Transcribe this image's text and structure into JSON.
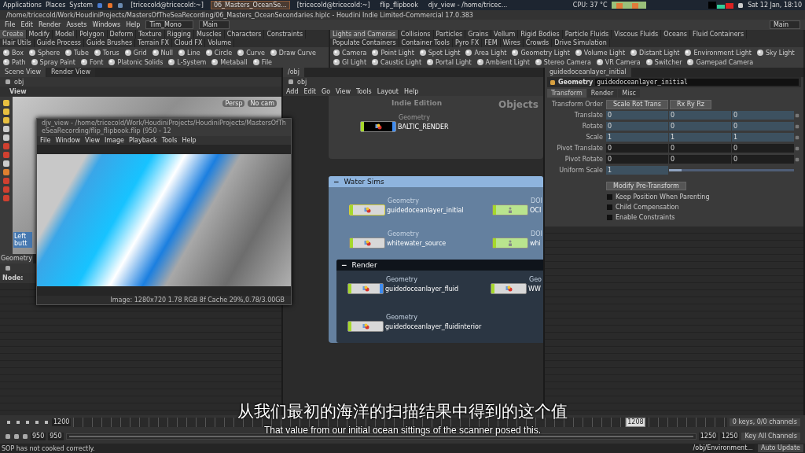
{
  "system_bar": {
    "menus": [
      "Applications",
      "Places",
      "System"
    ],
    "tasks": [
      {
        "label": "[tricecold@tricecold:~]",
        "selected": false
      },
      {
        "label": "06_Masters_OceanSe...",
        "selected": true
      },
      {
        "label": "[tricecold@tricecold:~]",
        "selected": false
      },
      {
        "label": "flip_flipbook",
        "selected": false
      },
      {
        "label": "djv_view - /home/tricec...",
        "selected": false
      }
    ],
    "cpu": "CPU: 37 °C",
    "clock": "Sat 12 Jan, 18:10"
  },
  "window": {
    "title": "/home/tricecold/Work/HoudiniProjects/MastersOfTheSeaRecording/06_Masters_OceanSecondaries.hiplc - Houdini Indie Limited-Commercial 17.0.383"
  },
  "menu": {
    "items": [
      "File",
      "Edit",
      "Render",
      "Assets",
      "Windows",
      "Help"
    ],
    "desktop": "Tim_Mono",
    "layout": "Main",
    "right_layout": "Main"
  },
  "shelves": [
    {
      "tabs": [
        {
          "label": "Create",
          "selected": true
        },
        {
          "label": "Modify",
          "selected": false
        },
        {
          "label": "Model",
          "selected": false
        },
        {
          "label": "Polygon",
          "selected": false
        },
        {
          "label": "Deform",
          "selected": false
        },
        {
          "label": "Texture",
          "selected": false
        },
        {
          "label": "Rigging",
          "selected": false
        },
        {
          "label": "Muscles",
          "selected": false
        },
        {
          "label": "Characters",
          "selected": false
        },
        {
          "label": "Constraints",
          "selected": false
        },
        {
          "label": "Hair Utils",
          "selected": false
        },
        {
          "label": "Guide Process",
          "selected": false
        },
        {
          "label": "Guide Brushes",
          "selected": false
        },
        {
          "label": "Terrain FX",
          "selected": false
        },
        {
          "label": "Cloud FX",
          "selected": false
        },
        {
          "label": "Volume",
          "selected": false
        }
      ],
      "tools": [
        "Box",
        "Sphere",
        "Tube",
        "Torus",
        "Grid",
        "Null",
        "Line",
        "Circle",
        "Curve",
        "Draw Curve",
        "Path",
        "Spray Paint",
        "Font",
        "Platonic Solids",
        "L-System",
        "Metaball",
        "File"
      ]
    },
    {
      "tabs": [
        {
          "label": "Lights and Cameras",
          "selected": true
        },
        {
          "label": "Collisions",
          "selected": false
        },
        {
          "label": "Particles",
          "selected": false
        },
        {
          "label": "Grains",
          "selected": false
        },
        {
          "label": "Vellum",
          "selected": false
        },
        {
          "label": "Rigid Bodies",
          "selected": false
        },
        {
          "label": "Particle Fluids",
          "selected": false
        },
        {
          "label": "Viscous Fluids",
          "selected": false
        },
        {
          "label": "Oceans",
          "selected": false
        },
        {
          "label": "Fluid Containers",
          "selected": false
        },
        {
          "label": "Populate Containers",
          "selected": false
        },
        {
          "label": "Container Tools",
          "selected": false
        },
        {
          "label": "Pyro FX",
          "selected": false
        },
        {
          "label": "FEM",
          "selected": false
        },
        {
          "label": "Wires",
          "selected": false
        },
        {
          "label": "Crowds",
          "selected": false
        },
        {
          "label": "Drive Simulation",
          "selected": false
        }
      ],
      "tools": [
        "Camera",
        "Point Light",
        "Spot Light",
        "Area Light",
        "Geometry Light",
        "Volume Light",
        "Distant Light",
        "Environment Light",
        "Sky Light",
        "GI Light",
        "Caustic Light",
        "Portal Light",
        "Ambient Light",
        "Stereo Camera",
        "VR Camera",
        "Switcher",
        "Gamepad Camera"
      ]
    }
  ],
  "scene_view": {
    "tabs": [
      {
        "label": "Scene View",
        "selected": true
      },
      {
        "label": "Render View",
        "selected": false
      }
    ],
    "path": "obj",
    "header": "View",
    "camera": "Persp",
    "cam": "No cam",
    "hint": "Left butt",
    "geometry_tab": "Geometry",
    "node_label": "Node:"
  },
  "flipbook": {
    "title": "djv_view - /home/tricecold/Work/HoudiniProjects/HoudiniProjects/MastersOfTheSeaRecording/flip_flipbook.flip (950 - 12",
    "menus": [
      "File",
      "Window",
      "View",
      "Image",
      "Playback",
      "Tools",
      "Help"
    ],
    "status": "Image: 1280x720 1.78 RGB 8f Cache 29%,0.78/3.00GB"
  },
  "network": {
    "tab": "/obj",
    "path": "obj",
    "menus": [
      "Add",
      "Edit",
      "Go",
      "View",
      "Tools",
      "Layout",
      "Help"
    ],
    "edition": "Indie Edition",
    "context": "Objects",
    "top_node": {
      "type": "Geometry",
      "name": "BALTIC_RENDER",
      "kind": "geo",
      "selected": false,
      "render": true
    },
    "boxes": [
      {
        "title": "Water Sims",
        "toggle": "−",
        "expanded": true,
        "nodes": [
          {
            "type": "Geometry",
            "name": "guidedoceanlayer_initial",
            "kind": "geo",
            "selected": true,
            "render": false
          },
          {
            "type": "DOI",
            "name": "OCI",
            "kind": "dop",
            "selected": false,
            "render": false
          },
          {
            "type": "Geometry",
            "name": "whitewater_source",
            "kind": "geo",
            "selected": false,
            "render": false
          },
          {
            "type": "DOI",
            "name": "whi",
            "kind": "dop",
            "selected": false,
            "render": false
          }
        ],
        "children": [
          {
            "title": "Render",
            "toggle": "−",
            "expanded": true,
            "nodes": [
              {
                "type": "Geometry",
                "name": "guidedoceanlayer_fluid",
                "kind": "geo",
                "selected": false,
                "render": true
              },
              {
                "type": "Geo",
                "name": "WW",
                "kind": "geo",
                "selected": false,
                "render": false
              },
              {
                "type": "Geometry",
                "name": "guidedoceanlayer_fluidinterior",
                "kind": "geo",
                "selected": false,
                "render": false
              }
            ]
          }
        ]
      }
    ]
  },
  "parameters": {
    "tab": "guidedoceanlayer_initial",
    "type": "Geometry",
    "name": "guidedoceanlayer_initial",
    "tabs": [
      {
        "label": "Transform",
        "selected": true
      },
      {
        "label": "Render",
        "selected": false
      },
      {
        "label": "Misc",
        "selected": false
      }
    ],
    "order_label": "Transform Order",
    "order": "Scale Rot Trans",
    "rotation_order": "Rx Ry Rz",
    "rows": [
      {
        "label": "Translate",
        "values": [
          "0",
          "0",
          "0"
        ],
        "kind": "vector"
      },
      {
        "label": "Rotate",
        "values": [
          "0",
          "0",
          "0"
        ],
        "kind": "vector"
      },
      {
        "label": "Scale",
        "values": [
          "1",
          "1",
          "1"
        ],
        "kind": "vector"
      },
      {
        "label": "Pivot Translate",
        "values": [
          "0",
          "0",
          "0"
        ],
        "kind": "dark"
      },
      {
        "label": "Pivot Rotate",
        "values": [
          "0",
          "0",
          "0"
        ],
        "kind": "dark"
      }
    ],
    "uniform_scale": {
      "label": "Uniform Scale",
      "value": "1",
      "level": 0.1
    },
    "pre_transform": "Modify Pre-Transform",
    "checks": [
      {
        "label": "Keep Position When Parenting",
        "checked": false
      },
      {
        "label": "Child Compensation",
        "checked": false
      },
      {
        "label": "Enable Constraints",
        "checked": false
      }
    ]
  },
  "timeline": {
    "frame": "1200",
    "marker": "1208",
    "level": 0.86,
    "range": {
      "level": 1
    },
    "start": "950",
    "start_field": "950",
    "end": "1250",
    "end_field": "1250",
    "keys": "0 keys, 0/0 channels",
    "key_all": "Key All Channels"
  },
  "status_bar": {
    "message": "SOP has not cooked correctly.",
    "path": "/obj/Environment...",
    "update": "Auto Update"
  },
  "subtitles": {
    "zh": "从我们最初的海洋的扫描结果中得到的这个值",
    "en": "That value from our initial ocean sittings of the scanner posed this."
  }
}
